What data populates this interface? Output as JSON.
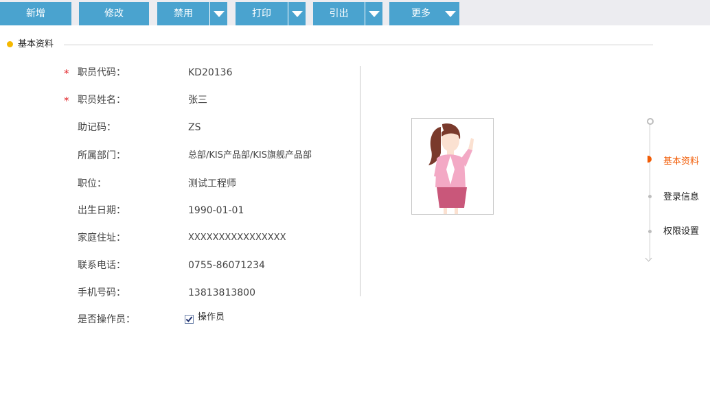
{
  "toolbar": {
    "buttons": [
      {
        "label": "新增"
      },
      {
        "label": "修改"
      },
      {
        "label": "禁用"
      },
      {
        "label": "打印"
      },
      {
        "label": "引出"
      },
      {
        "label": "更多"
      }
    ]
  },
  "section": {
    "title": "基本资料"
  },
  "form": {
    "fields": [
      {
        "label": "职员代码：",
        "value": "KD20136",
        "required": true
      },
      {
        "label": "职员姓名：",
        "value": "张三",
        "required": true
      },
      {
        "label": "助记码：",
        "value": "ZS",
        "required": false
      },
      {
        "label": "所属部门：",
        "value": "总部/KIS产品部/KIS旗舰产品部",
        "required": false
      },
      {
        "label": "职位：",
        "value": "测试工程师",
        "required": false
      },
      {
        "label": "出生日期：",
        "value": "1990-01-01",
        "required": false
      },
      {
        "label": "家庭住址：",
        "value": "XXXXXXXXXXXXXXXX",
        "required": false
      },
      {
        "label": "联系电话：",
        "value": "0755-86071234",
        "required": false
      },
      {
        "label": "手机号码：",
        "value": "13813813800",
        "required": false
      }
    ],
    "operator": {
      "label": "是否操作员：",
      "checkbox_label": "操作员",
      "checked": true
    },
    "required_mark": "*"
  },
  "nav": {
    "items": [
      {
        "label": "基本资料",
        "active": true
      },
      {
        "label": "登录信息",
        "active": false
      },
      {
        "label": "权限设置",
        "active": false
      }
    ]
  },
  "colors": {
    "toolbar_button": "#4aa3cf",
    "accent_active": "#f25c05",
    "required": "#e2262b",
    "section_dot": "#f5b800"
  }
}
